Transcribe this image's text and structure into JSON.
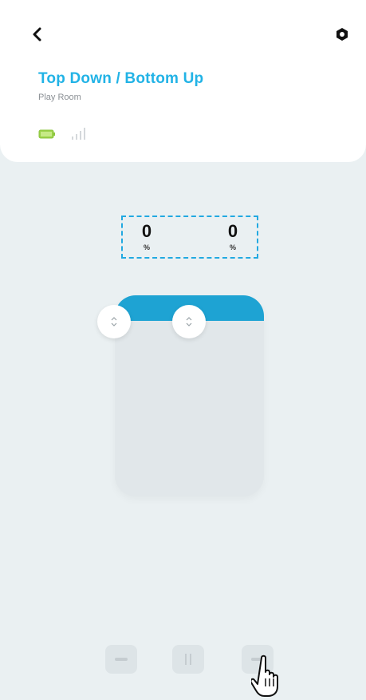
{
  "header": {
    "back_icon": "chevron-left-icon",
    "settings_icon": "gear-icon",
    "title": "Top Down / Bottom Up",
    "room": "Play Room",
    "battery_icon": "battery-icon",
    "signal_icon": "signal-icon"
  },
  "position": {
    "top_value": "0",
    "top_unit": "%",
    "bottom_value": "0",
    "bottom_unit": "%"
  },
  "shade": {
    "top_rail_icon": "drag-handle-icon",
    "bottom_rail_icon": "drag-handle-icon",
    "fabric_color": "#1ea3d3"
  },
  "controls": {
    "close_icon": "minus-icon",
    "stop_icon": "pause-icon",
    "open_icon": "plus-icon"
  },
  "colors": {
    "accent": "#22b3e6",
    "battery": "#9bd24a",
    "background": "#eaf0f2"
  }
}
